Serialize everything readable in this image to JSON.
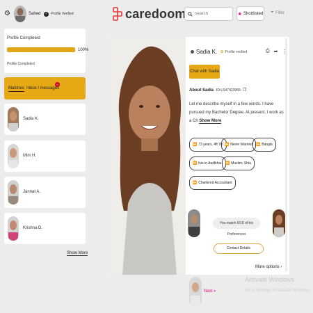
{
  "user": {
    "name": "Sahed",
    "verified_label": "Profile Verified"
  },
  "profile_completion": {
    "label": "Profile Completed",
    "percent_text": "100%",
    "percent": 100,
    "sub_label": "Profile Completed"
  },
  "tabs": {
    "matches": "Matches",
    "inbox": "Inbox / messages",
    "inbox_badge": "0"
  },
  "matches": [
    {
      "name": "Sadia K."
    },
    {
      "name": "Mim H."
    },
    {
      "name": "Jannat A."
    },
    {
      "name": "Krishna D."
    }
  ],
  "show_more": "Show More",
  "header": {
    "brand": "caredoom",
    "search_placeholder": "Search",
    "shortlisted": "Shortlisted",
    "filter": "Filter"
  },
  "profile": {
    "name": "Sadia K.",
    "verified": "Profile verified.",
    "chat_button": "Chat with Sadia",
    "about_title": "About Sadia",
    "id": "ID:LS47423955",
    "description": "Let me describe myself in a few words. I have pursued my Bachelor Degree. At present, I work as a Ch",
    "show_more": "Show More",
    "chips": [
      "73 years, 4ft 7in",
      "Never Married",
      "Bangla",
      "live in Aedlkhau",
      "Muslim, Shia",
      "Chartered Accountant"
    ],
    "match_text": "You match 6/10 of his Preferences",
    "contact_details": "Contact Details",
    "more_options": "More options",
    "next": "Next"
  },
  "watermark": {
    "line1": "Activate Windows",
    "line2": "Go to Settings to activate Windows."
  },
  "colors": {
    "accent": "#e6a915",
    "brand_pink": "#e9007a",
    "badge": "#c4001d"
  }
}
